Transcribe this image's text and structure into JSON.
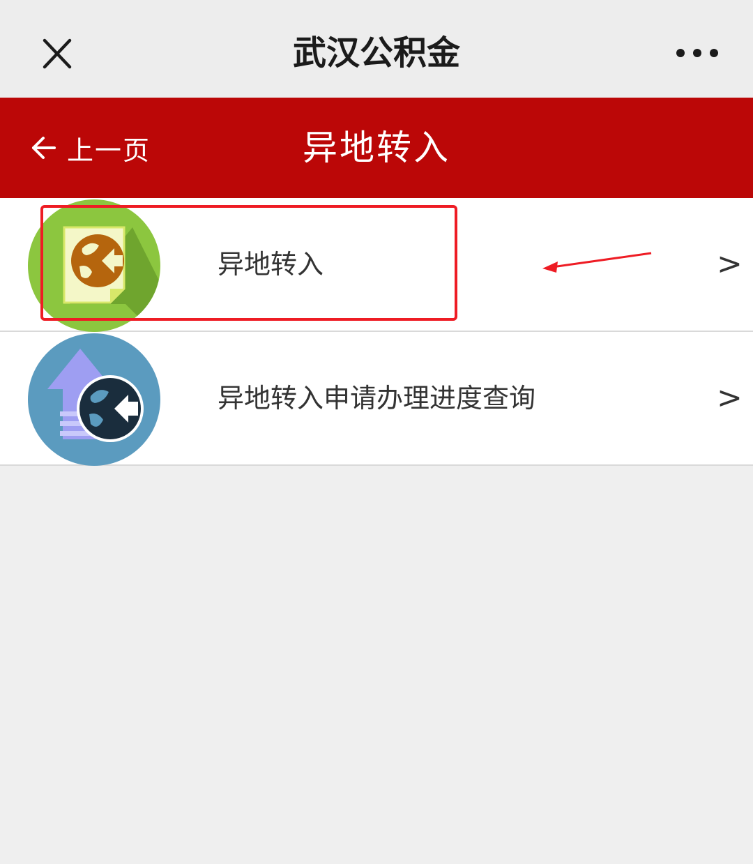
{
  "window": {
    "title": "武汉公积金"
  },
  "header": {
    "back_label": "上一页",
    "title": "异地转入"
  },
  "list": {
    "items": [
      {
        "label": "异地转入",
        "chevron": ">",
        "icon": "globe-document-icon"
      },
      {
        "label": "异地转入申请办理进度查询",
        "chevron": ">",
        "icon": "upload-globe-icon"
      }
    ]
  },
  "annotation": {
    "highlight_color": "#ee1c24",
    "highlighted_item": "异地转入"
  },
  "colors": {
    "header_bg": "#bb0707",
    "page_bg": "#efefef",
    "topbar_bg": "#ededed"
  }
}
